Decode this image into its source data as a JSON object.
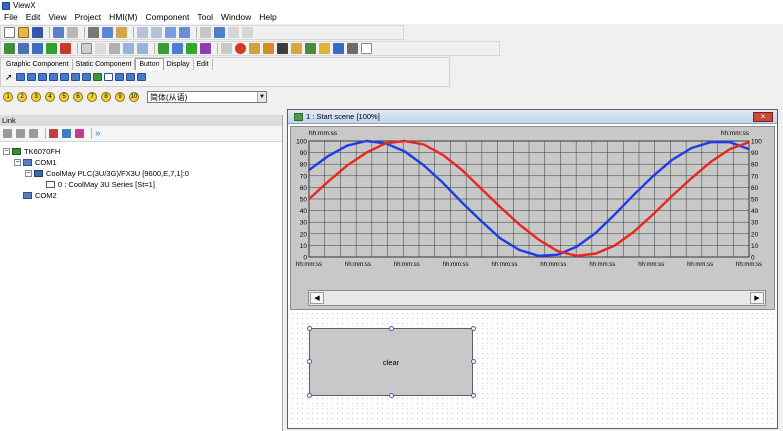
{
  "titlebar": {
    "title": "ViewX",
    "icon": "viewx-app-icon"
  },
  "menu": [
    "File",
    "Edit",
    "View",
    "Project",
    "HMI(M)",
    "Component",
    "Tool",
    "Window",
    "Help"
  ],
  "component_tabs": [
    "Graphic Component",
    "Static Component",
    "Button",
    "Display",
    "Edit"
  ],
  "function_keys": [
    "1",
    "2",
    "3",
    "4",
    "5",
    "6",
    "7",
    "8",
    "9",
    "10"
  ],
  "language_select": {
    "value": "简体(从语)"
  },
  "link_panel": {
    "title": "Link",
    "tree": {
      "root": "TK6070FH",
      "com1": "COM1",
      "plc": "CoolMay PLC(3U/3G)/FX3U [9600,E,7,1]:0",
      "station": "0 : CoolMay 3U Series [St=1]",
      "com2": "COM2"
    }
  },
  "scene_window": {
    "title": "1 : Start scene [100%]",
    "close_label": "×"
  },
  "trend": {
    "header_left": "hh:mm:ss",
    "header_right": "hh:mm:ss",
    "time_label": "hh:mm:ss"
  },
  "clear_button": {
    "label": "clear"
  },
  "colors": {
    "series_1": "#1f3ce8",
    "series_2": "#e8281f",
    "trend_bg": "#c8c8c8"
  },
  "chart_data": {
    "type": "line",
    "ylim": [
      0,
      100
    ],
    "yticks": [
      0,
      10,
      20,
      30,
      40,
      50,
      60,
      70,
      80,
      90,
      100
    ],
    "xtick_labels": [
      "hh:mm:ss",
      "hh:mm:ss",
      "hh:mm:ss",
      "hh:mm:ss",
      "hh:mm:ss",
      "hh:mm:ss",
      "hh:mm:ss",
      "hh:mm:ss",
      "hh:mm:ss",
      "hh:mm:ss"
    ],
    "grid": true,
    "series": [
      {
        "color": "#1f3ce8",
        "values": [
          75,
          87,
          96,
          100,
          98,
          91,
          79,
          64,
          47,
          31,
          16,
          6,
          1,
          2,
          9,
          21,
          37,
          54,
          70,
          84,
          94,
          99,
          99,
          93
        ]
      },
      {
        "color": "#e8281f",
        "values": [
          50,
          65,
          79,
          90,
          98,
          100,
          97,
          88,
          75,
          59,
          43,
          28,
          15,
          5,
          1,
          3,
          10,
          22,
          37,
          53,
          68,
          82,
          93,
          99
        ]
      }
    ]
  }
}
